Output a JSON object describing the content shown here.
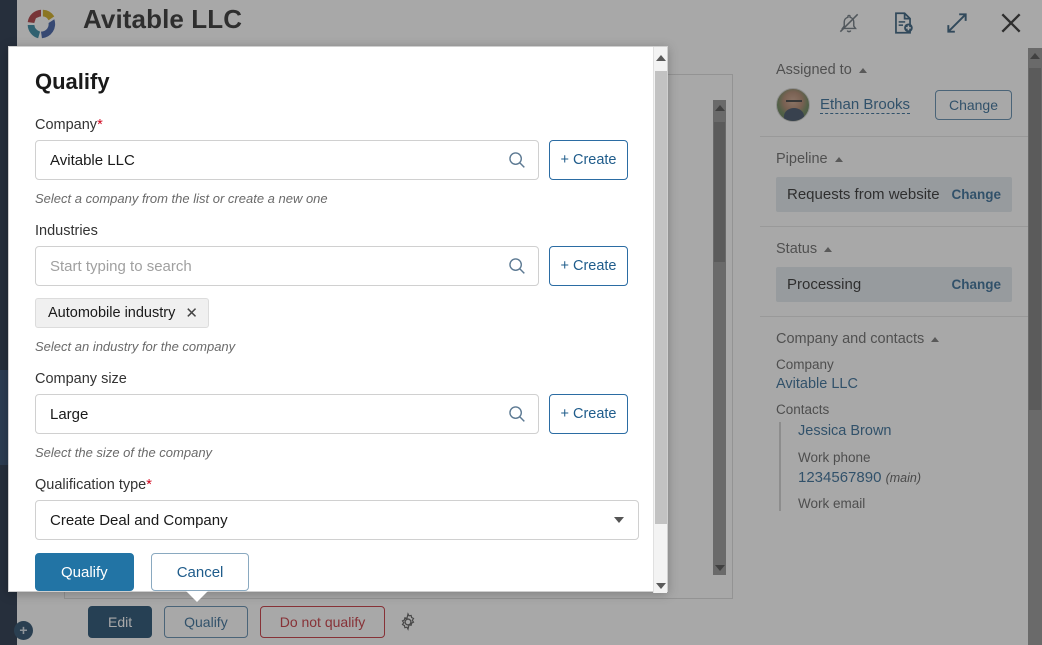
{
  "app": {
    "title": "Avitable LLC",
    "logo_name": "crm-logo",
    "header_icons": [
      {
        "name": "bell-off-icon",
        "label": "Notifications off"
      },
      {
        "name": "document-add-icon",
        "label": "Add document"
      },
      {
        "name": "expand-icon",
        "label": "Expand"
      },
      {
        "name": "close-icon",
        "label": "Close"
      }
    ],
    "nav": {
      "add_label": "+"
    }
  },
  "modal": {
    "title": "Qualify",
    "fields": {
      "company": {
        "label": "Company",
        "required": true,
        "value": "Avitable LLC",
        "placeholder": "Start typing to search",
        "hint": "Select a company from the list or create a new one",
        "create_label": "Create"
      },
      "industries": {
        "label": "Industries",
        "required": false,
        "value": "",
        "placeholder": "Start typing to search",
        "hint": "Select an industry for the company",
        "create_label": "Create",
        "chips": [
          {
            "label": "Automobile industry",
            "remove": "✕"
          }
        ]
      },
      "company_size": {
        "label": "Company size",
        "required": false,
        "value": "Large",
        "placeholder": "Start typing to search",
        "hint": "Select the size of the company",
        "create_label": "Create"
      },
      "qualification_type": {
        "label": "Qualification type",
        "required": true,
        "value": "Create Deal and Company"
      }
    },
    "actions": {
      "submit_label": "Qualify",
      "cancel_label": "Cancel"
    }
  },
  "toolbar": {
    "edit_label": "Edit",
    "qualify_label": "Qualify",
    "do_not_qualify_label": "Do not qualify",
    "settings_icon": "gear-icon"
  },
  "right_panel": {
    "assigned_to": {
      "heading": "Assigned to",
      "user": "Ethan Brooks",
      "change_label": "Change"
    },
    "pipeline": {
      "heading": "Pipeline",
      "value": "Requests from website",
      "change_label": "Change"
    },
    "status": {
      "heading": "Status",
      "value": "Processing",
      "change_label": "Change"
    },
    "company_and_contacts": {
      "heading": "Company and contacts",
      "company_label": "Company",
      "company_value": "Avitable LLC",
      "contacts_label": "Contacts",
      "contacts": [
        {
          "name": "Jessica Brown",
          "work_phone_label": "Work phone",
          "work_phone": "1234567890",
          "work_phone_note": "(main)",
          "work_email_label": "Work email"
        }
      ]
    }
  },
  "colors": {
    "accent_blue": "#2274a5",
    "dark_navy": "#0b3c61",
    "danger_red": "#c0202a",
    "link_blue": "#1f5c8b",
    "required_red": "#d0021b",
    "value_bar": "#dfe6ec",
    "rail": "#0b1b33"
  }
}
